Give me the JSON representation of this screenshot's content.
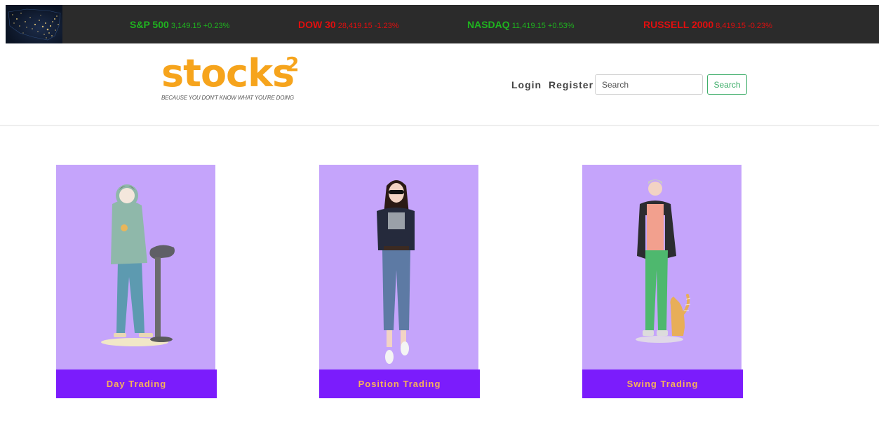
{
  "ticker": [
    {
      "name": "S&P 500",
      "value": "3,149.15",
      "change": "+0.23%",
      "direction": "up"
    },
    {
      "name": "DOW 30",
      "value": "28,419.15",
      "change": "-1.23%",
      "direction": "down"
    },
    {
      "name": "NASDAQ",
      "value": "11,419.15",
      "change": "+0.53%",
      "direction": "up"
    },
    {
      "name": "RUSSELL 2000",
      "value": "8,419.15",
      "change": "-0.23%",
      "direction": "down"
    }
  ],
  "colors": {
    "up": "#1fb41f",
    "down": "#e20e0e",
    "brand": "#f6a41c",
    "card_bg": "#c5a4fb",
    "card_label_bg": "#7b1cfc",
    "card_label_text": "#f7b15a",
    "search_accent": "#3fae6a"
  },
  "header": {
    "logo_text": "stocks",
    "logo_superscript": "2",
    "tagline": "BECAUSE YOU DON'T KNOW WHAT YOU'RE DOING",
    "nav": {
      "login": "Login",
      "register": "Register"
    },
    "search": {
      "placeholder": "Search",
      "value": "",
      "button_label": "Search"
    }
  },
  "cards": [
    {
      "label": "Day Trading",
      "illustration": "person-in-hoodie-with-stool"
    },
    {
      "label": "Position Trading",
      "illustration": "woman-with-sunglasses"
    },
    {
      "label": "Swing Trading",
      "illustration": "man-in-green-pants-with-cat"
    }
  ]
}
